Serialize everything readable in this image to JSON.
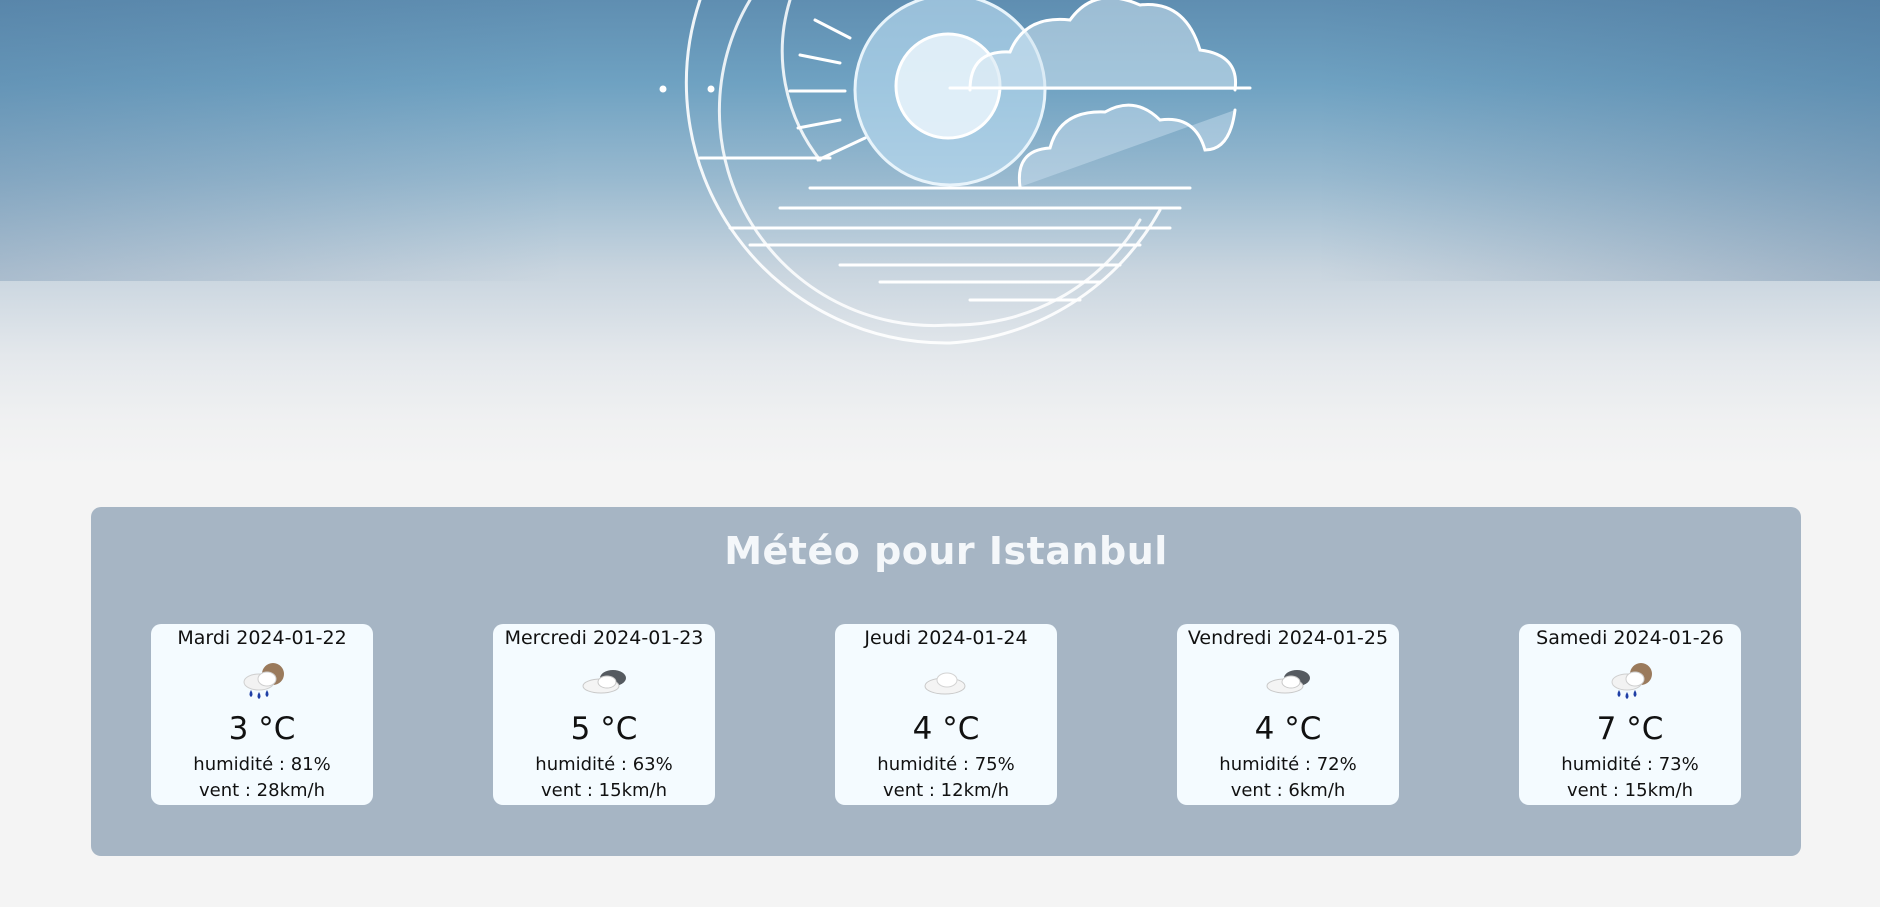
{
  "title": "Météo pour Istanbul",
  "forecast": [
    {
      "day": "Mardi 2024-01-22",
      "icon": "rain-cloud-icon",
      "temp": "3 °C",
      "humidity": "humidité : 81%",
      "wind": "vent : 28km/h"
    },
    {
      "day": "Mercredi 2024-01-23",
      "icon": "cloudy-icon",
      "temp": "5 °C",
      "humidity": "humidité : 63%",
      "wind": "vent : 15km/h"
    },
    {
      "day": "Jeudi 2024-01-24",
      "icon": "cloud-icon",
      "temp": "4 °C",
      "humidity": "humidité : 75%",
      "wind": "vent : 12km/h"
    },
    {
      "day": "Vendredi 2024-01-25",
      "icon": "cloudy-icon",
      "temp": "4 °C",
      "humidity": "humidité : 72%",
      "wind": "vent : 6km/h"
    },
    {
      "day": "Samedi 2024-01-26",
      "icon": "rain-cloud-icon",
      "temp": "7 °C",
      "humidity": "humidité : 73%",
      "wind": "vent : 15km/h"
    }
  ],
  "colors": {
    "panel": "#a6b5c4",
    "card": "#f4fbff",
    "title": "#f4f7fa"
  }
}
